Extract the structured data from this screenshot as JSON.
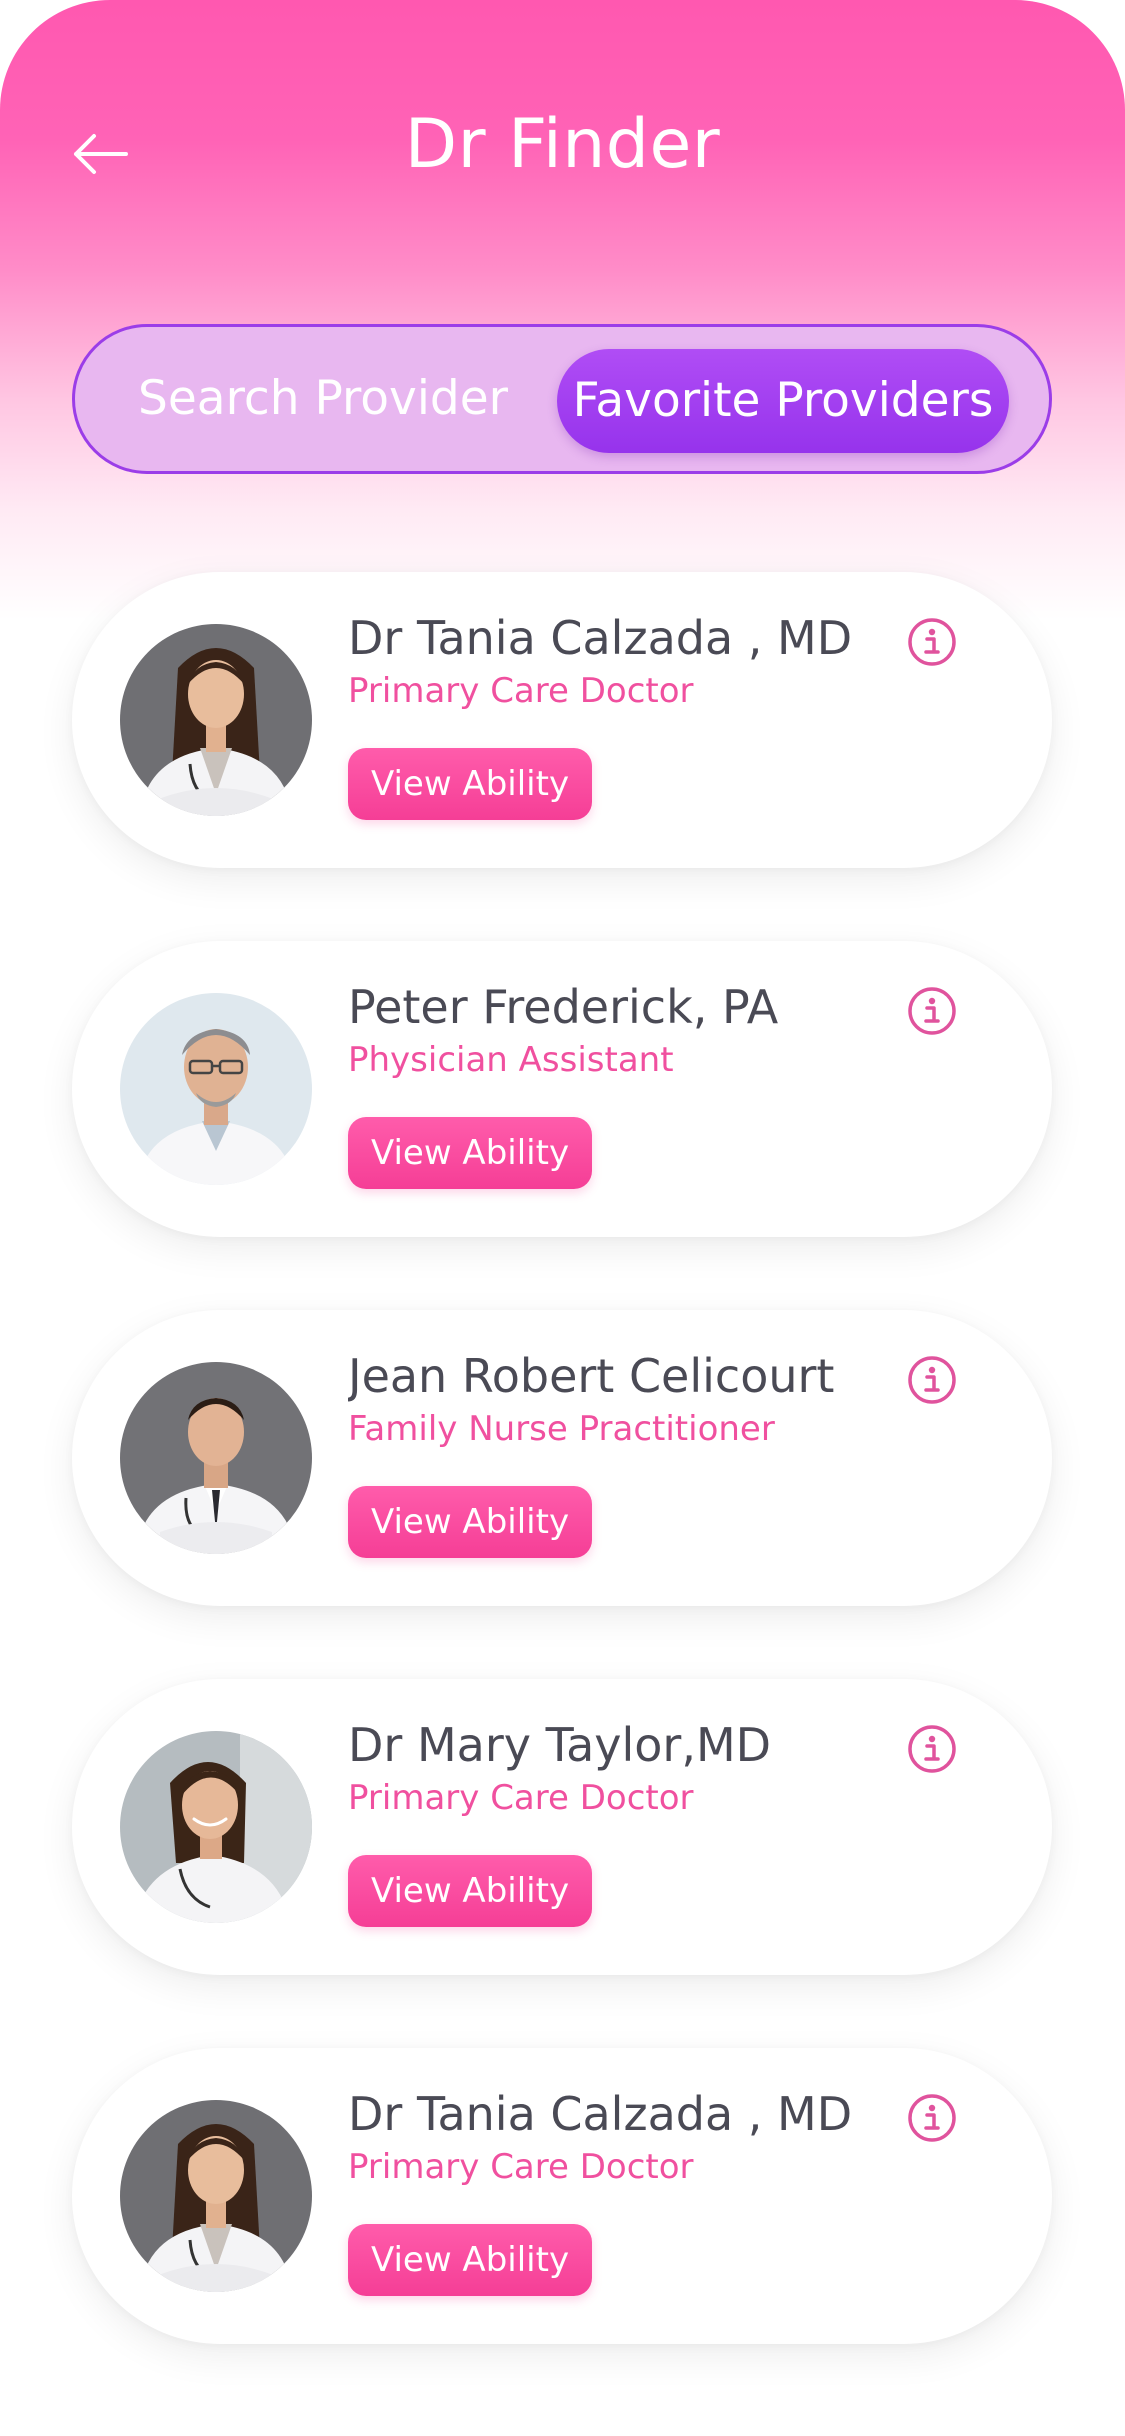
{
  "header": {
    "title": "Dr Finder",
    "back_icon": "arrow-left-icon"
  },
  "tabs": [
    {
      "label": "Search Provider",
      "active": false
    },
    {
      "label": "Favorite Providers",
      "active": true
    }
  ],
  "providers": [
    {
      "name": "Dr Tania Calzada , MD",
      "role": "Primary Care Doctor",
      "button": "View Ability",
      "photo": "female-doctor-photo",
      "info_icon": "info-icon"
    },
    {
      "name": "Peter Frederick, PA",
      "role": "Physician Assistant",
      "button": "View Ability",
      "photo": "male-doctor-photo",
      "info_icon": "info-icon"
    },
    {
      "name": "Jean Robert Celicourt",
      "role": "Family Nurse Practitioner",
      "button": "View Ability",
      "photo": "young-male-doctor-photo",
      "info_icon": "info-icon"
    },
    {
      "name": "Dr Mary Taylor,MD",
      "role": "Primary Care Doctor",
      "button": "View Ability",
      "photo": "smiling-female-doctor-photo",
      "info_icon": "info-icon"
    },
    {
      "name": "Dr Tania Calzada , MD",
      "role": "Primary Care Doctor",
      "button": "View Ability",
      "photo": "female-doctor-photo",
      "info_icon": "info-icon"
    }
  ],
  "colors": {
    "header_pink": "#ff58b0",
    "accent_pink": "#f0509f",
    "button_pink": "#f53e96",
    "purple": "#9b3de8",
    "name_text": "#4a4a55"
  }
}
